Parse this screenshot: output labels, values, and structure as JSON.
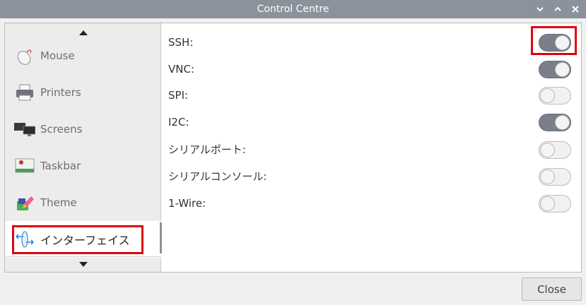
{
  "window": {
    "title": "Control Centre",
    "buttons": [
      "minimize-icon",
      "maximize-icon",
      "close-icon"
    ]
  },
  "sidebar": {
    "items": [
      {
        "label": "Mouse",
        "icon": "mouse-icon"
      },
      {
        "label": "Printers",
        "icon": "printer-icon"
      },
      {
        "label": "Screens",
        "icon": "screens-icon"
      },
      {
        "label": "Taskbar",
        "icon": "taskbar-icon"
      },
      {
        "label": "Theme",
        "icon": "theme-icon"
      },
      {
        "label": "インターフェイス",
        "icon": "interfaces-icon",
        "selected": true
      }
    ],
    "scroll_up_icon": "triangle-up-icon",
    "scroll_down_icon": "triangle-down-icon"
  },
  "interfaces": [
    {
      "label": "SSH:",
      "enabled": true
    },
    {
      "label": "VNC:",
      "enabled": true
    },
    {
      "label": "SPI:",
      "enabled": false
    },
    {
      "label": "I2C:",
      "enabled": true
    },
    {
      "label": "シリアルポート:",
      "enabled": false
    },
    {
      "label": "シリアルコンソール:",
      "enabled": false
    },
    {
      "label": "1-Wire:",
      "enabled": false
    }
  ],
  "footer": {
    "close_label": "Close"
  },
  "colors": {
    "titlebar": "#8c929b",
    "toggle_on": "#7a8089",
    "highlight": "#e0000b"
  }
}
